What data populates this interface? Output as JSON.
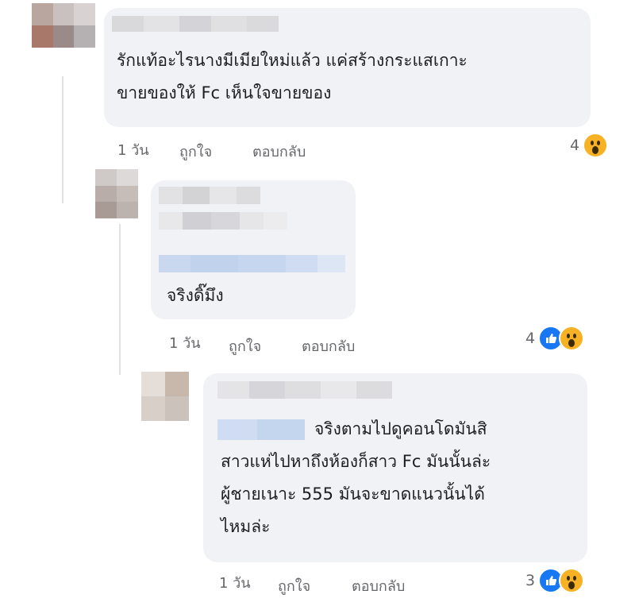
{
  "comments": [
    {
      "text": "รักแท้อะไรนางมีเมียใหม่แล้ว แค่สร้างกระแสเกาะ\nขายของให้ Fc เห็นใจขายของ",
      "time": "1 วัน",
      "like_label": "ถูกใจ",
      "reply_label": "ตอบกลับ",
      "reaction_count": "4",
      "reactions": [
        "wow-icon"
      ]
    },
    {
      "text": "จริงดิ๊มึง",
      "time": "1 วัน",
      "like_label": "ถูกใจ",
      "reply_label": "ตอบกลับ",
      "reaction_count": "4",
      "reactions": [
        "like-icon",
        "wow-icon"
      ]
    },
    {
      "text": "จริงตามไปดูคอนโดมันสิ\nสาวแห่ไปหาถึงห้องก็สาว Fc มันนั้นล่ะ\nผู้ชายเนาะ 555 มันจะขาดแนวนั้นได้\nไหมล่ะ",
      "time": "1 วัน",
      "like_label": "ถูกใจ",
      "reply_label": "ตอบกลับ",
      "reaction_count": "3",
      "reactions": [
        "like-icon",
        "wow-icon"
      ]
    }
  ],
  "colors": {
    "bubble": "#f0f2f5",
    "meta_text": "#65676b",
    "like_blue": "#1877f2",
    "wow_yellow": "#f7b125"
  }
}
